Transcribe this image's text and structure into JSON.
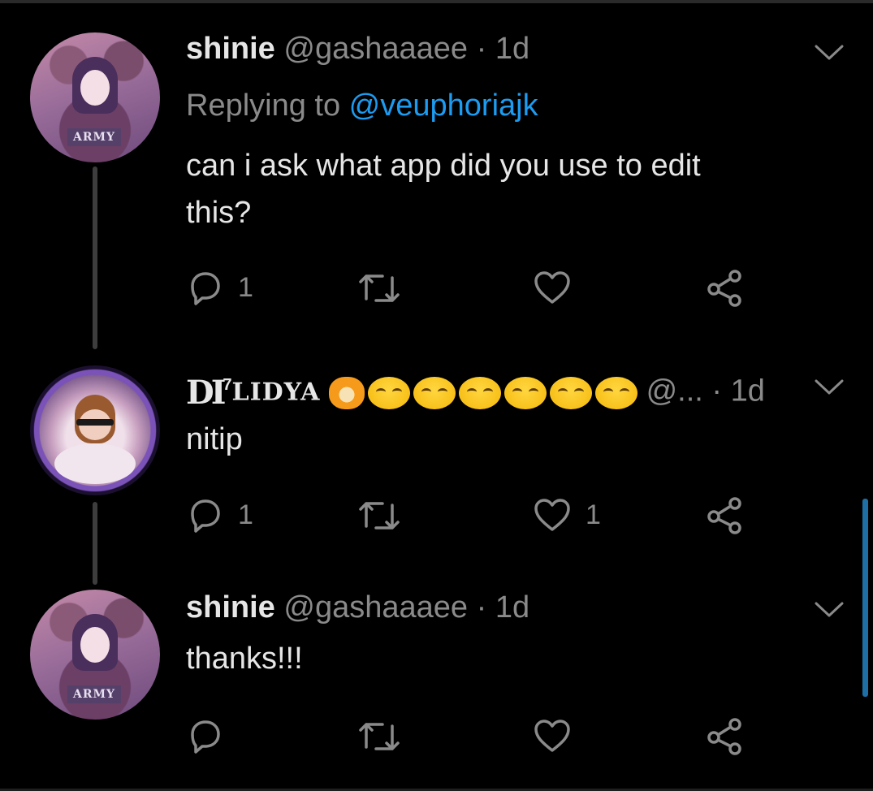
{
  "tweets": [
    {
      "name": "shinie",
      "handle": "@gashaaaee",
      "separator": "·",
      "time": "1d",
      "reply_prefix": "Replying to ",
      "reply_mention": "@veuphoriajk",
      "text_line1": "can i ask what app did you use to edit",
      "text_line2": "this?",
      "reply_count": "1",
      "retweet_count": "",
      "like_count": "",
      "avatar_badge": "ARMY"
    },
    {
      "name_logo": "DI",
      "name_superscript": "7",
      "name": "LIDYA",
      "handle": "@...",
      "separator": "·",
      "time": "1d",
      "text": "nitip",
      "reply_count": "1",
      "retweet_count": "",
      "like_count": "1"
    },
    {
      "name": "shinie",
      "handle": "@gashaaaee",
      "separator": "·",
      "time": "1d",
      "text": "thanks!!!",
      "reply_count": "",
      "retweet_count": "",
      "like_count": "",
      "avatar_badge": "ARMY"
    }
  ],
  "colors": {
    "background": "#000000",
    "text": "#e6e6e6",
    "muted": "#8a8a8a",
    "link": "#1d9bf0",
    "scrollbar": "#1d6fa5"
  },
  "icons": [
    "reply-icon",
    "retweet-icon",
    "like-icon",
    "share-icon",
    "chevron-down-icon"
  ]
}
